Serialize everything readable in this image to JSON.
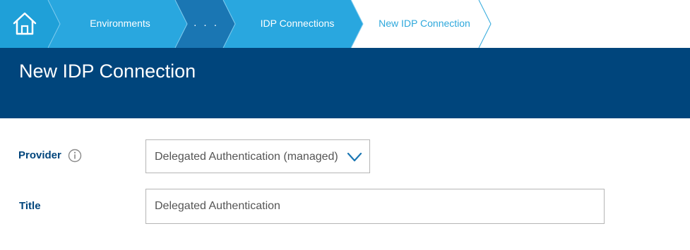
{
  "breadcrumb": {
    "home_icon": "home-icon",
    "items": [
      {
        "label": "Environments"
      },
      {
        "label": ". . ."
      },
      {
        "label": "IDP Connections"
      },
      {
        "label": "New IDP Connection"
      }
    ]
  },
  "header": {
    "title": "New IDP Connection"
  },
  "form": {
    "provider": {
      "label": "Provider",
      "info_icon": "info-icon",
      "selected": "Delegated Authentication (managed)",
      "dropdown_icon": "chevron-down-icon"
    },
    "title": {
      "label": "Title",
      "value": "Delegated Authentication"
    }
  },
  "colors": {
    "crumb_home": "#1fa0d8",
    "crumb_environments": "#29a7df",
    "crumb_ellipsis": "#1a76b3",
    "crumb_idp": "#29a7df",
    "header_band": "#00457c",
    "label_text": "#00457c",
    "current_crumb_text": "#2ea8dc"
  }
}
